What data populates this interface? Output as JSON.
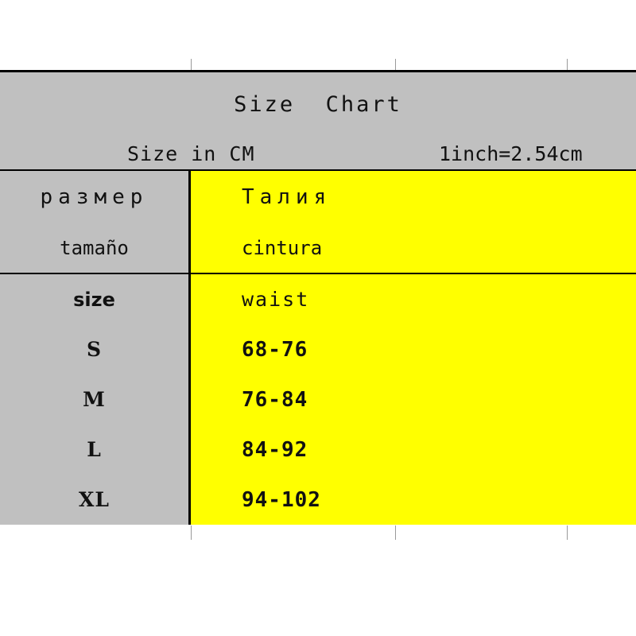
{
  "title": "Size  Chart",
  "units": {
    "left": "Size in CM",
    "right": "1inch=2.54cm"
  },
  "colors": {
    "header_bg": "#C0C0C0",
    "label_bg": "#C0C0C0",
    "value_bg": "#FFFF00",
    "border": "#000000",
    "text": "#111111"
  },
  "intro": {
    "label_ru": "размер",
    "label_es": "tamaño",
    "value_ru": "Талия",
    "value_es": "cintura"
  },
  "columns": {
    "size": "size",
    "waist": "waist"
  },
  "rows": [
    {
      "size": "S",
      "waist": "68-76"
    },
    {
      "size": "M",
      "waist": "76-84"
    },
    {
      "size": "L",
      "waist": "84-92"
    },
    {
      "size": "XL",
      "waist": "94-102"
    }
  ],
  "ticks": {
    "x_positions": [
      240,
      497,
      713
    ]
  }
}
